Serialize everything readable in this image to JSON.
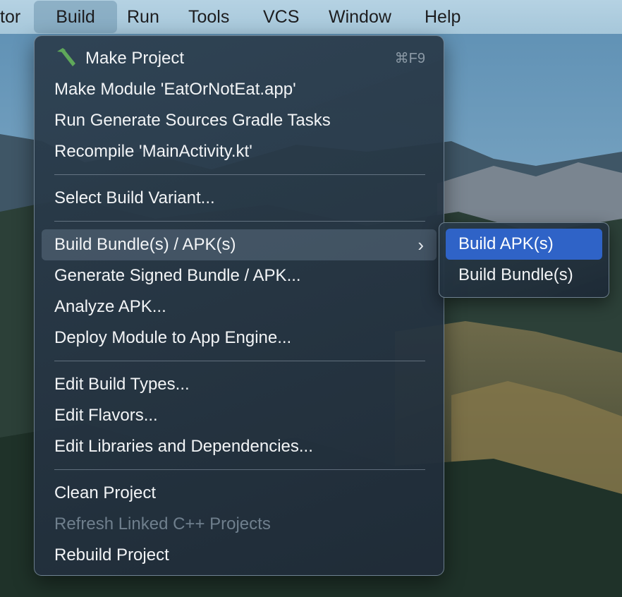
{
  "menubar": {
    "items": [
      {
        "label": "tor"
      },
      {
        "label": "Build",
        "active": true
      },
      {
        "label": "Run"
      },
      {
        "label": "Tools"
      },
      {
        "label": "VCS"
      },
      {
        "label": "Window"
      },
      {
        "label": "Help"
      }
    ]
  },
  "build_menu": {
    "groups": [
      [
        {
          "label": "Make Project",
          "icon": "hammer-icon",
          "shortcut": "⌘F9"
        },
        {
          "label": "Make Module 'EatOrNotEat.app'"
        },
        {
          "label": "Run Generate Sources Gradle Tasks"
        },
        {
          "label": "Recompile 'MainActivity.kt'"
        }
      ],
      [
        {
          "label": "Select Build Variant..."
        }
      ],
      [
        {
          "label": "Build Bundle(s) / APK(s)",
          "submenu": true,
          "chevron": "›",
          "highlighted": true
        },
        {
          "label": "Generate Signed Bundle / APK..."
        },
        {
          "label": "Analyze APK..."
        },
        {
          "label": "Deploy Module to App Engine..."
        }
      ],
      [
        {
          "label": "Edit Build Types..."
        },
        {
          "label": "Edit Flavors..."
        },
        {
          "label": "Edit Libraries and Dependencies..."
        }
      ],
      [
        {
          "label": "Clean Project"
        },
        {
          "label": "Refresh Linked C++ Projects",
          "disabled": true
        },
        {
          "label": "Rebuild Project"
        }
      ]
    ]
  },
  "submenu": {
    "items": [
      {
        "label": "Build APK(s)",
        "selected": true
      },
      {
        "label": "Build Bundle(s)"
      }
    ]
  },
  "colors": {
    "selection": "#2f63c7",
    "menu_bg": "#2c3e4e",
    "menubar_bg": "#b5d2e3",
    "hammer": "#5fa85a"
  }
}
